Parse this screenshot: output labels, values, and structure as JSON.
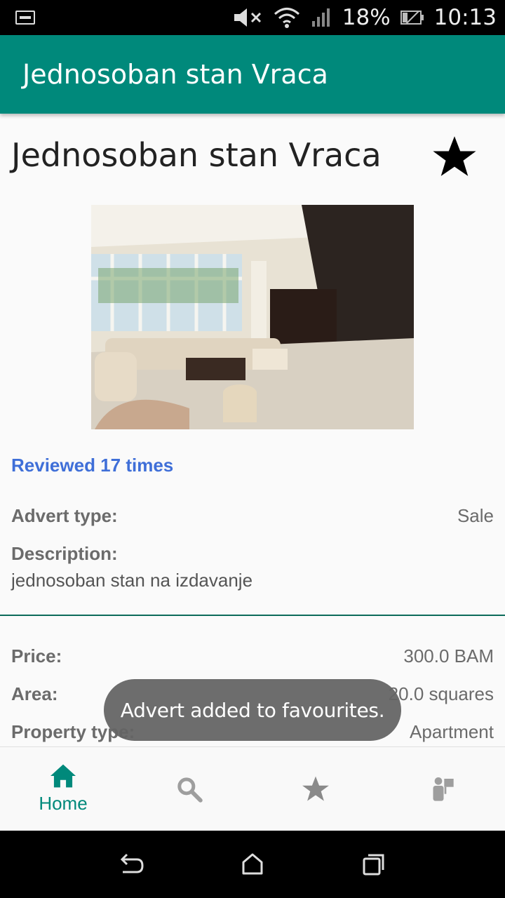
{
  "status_bar": {
    "battery": "18%",
    "time": "10:13"
  },
  "app_bar": {
    "title": "Jednosoban stan Vraca"
  },
  "listing": {
    "title": "Jednosoban stan Vraca",
    "favourite_icon": "star-icon",
    "image_alt": "living room photo",
    "reviewed": "Reviewed 17 times",
    "advert_type_label": "Advert type:",
    "advert_type_value": "Sale",
    "description_label": "Description:",
    "description_text": "jednosoban stan na izdavanje",
    "price_label": "Price:",
    "price_value": "300.0 BAM",
    "area_label": "Area:",
    "area_value": "20.0 squares",
    "property_type_label": "Property type:",
    "property_type_value": "Apartment"
  },
  "toast": {
    "message": "Advert added to favourites."
  },
  "bottom_nav": {
    "items": [
      {
        "label": "Home",
        "icon": "home-icon",
        "active": true
      },
      {
        "label": "",
        "icon": "search-icon",
        "active": false
      },
      {
        "label": "",
        "icon": "star-icon",
        "active": false
      },
      {
        "label": "",
        "icon": "agent-icon",
        "active": false
      }
    ]
  },
  "colors": {
    "primary": "#00897b",
    "link": "#3f6fd8",
    "divider": "#0b6b5a"
  }
}
